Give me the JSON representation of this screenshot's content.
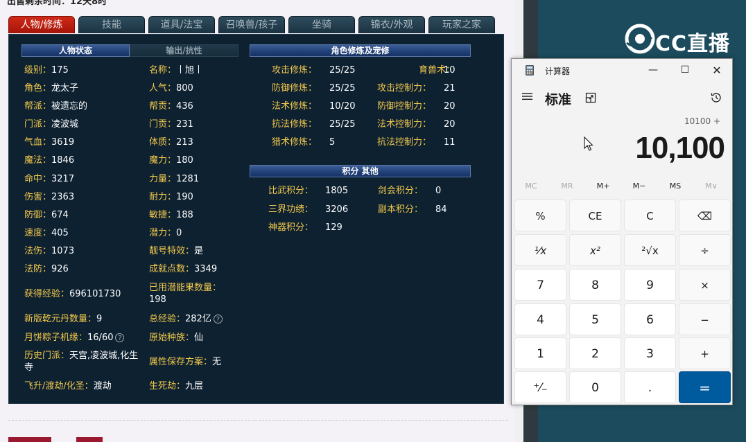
{
  "page": {
    "top_note": "出售剩余时间：12天8时",
    "tabs": [
      "人物/修炼",
      "技能",
      "道具/法宝",
      "召唤兽/孩子",
      "坐骑",
      "锦衣/外观",
      "玩家之家"
    ],
    "active_tab": "人物/修炼",
    "status": {
      "header_main": "人物状态",
      "header_alt": "输出/抗性",
      "col1": [
        {
          "label": "级别：",
          "value": "175"
        },
        {
          "label": "角色：",
          "value": "龙太子"
        },
        {
          "label": "帮派：",
          "value": "被遗忘的"
        },
        {
          "label": "门派：",
          "value": "凌波城"
        },
        {
          "label": "气血：",
          "value": "3619"
        },
        {
          "label": "魔法：",
          "value": "1846"
        },
        {
          "label": "命中：",
          "value": "3217"
        },
        {
          "label": "伤害：",
          "value": "2363"
        },
        {
          "label": "防御：",
          "value": "674"
        },
        {
          "label": "速度：",
          "value": "405"
        },
        {
          "label": "法伤：",
          "value": "1073"
        },
        {
          "label": "法防：",
          "value": "926"
        }
      ],
      "col2": [
        {
          "label": "名称：",
          "value": "丨旭丨"
        },
        {
          "label": "人气：",
          "value": "800"
        },
        {
          "label": "帮贡：",
          "value": "436"
        },
        {
          "label": "门贡：",
          "value": "231"
        },
        {
          "label": "体质：",
          "value": "213"
        },
        {
          "label": "魔力：",
          "value": "180"
        },
        {
          "label": "力量：",
          "value": "1281"
        },
        {
          "label": "耐力：",
          "value": "190"
        },
        {
          "label": "敏捷：",
          "value": "188"
        },
        {
          "label": "潜力：",
          "value": "0"
        },
        {
          "label": "靓号特效：",
          "value": "是"
        },
        {
          "label": "成就点数：",
          "value": "3349"
        }
      ],
      "exp_label": "获得经验：",
      "exp_value": "696101730",
      "used_fruit_label": "已用潜能果数量：",
      "used_fruit_value": "198",
      "qianyuan_label": "新版乾元丹数量：",
      "qianyuan_value": "9",
      "total_exp_label": "总经验：",
      "total_exp_value": "282亿",
      "zongzi_label": "月饼粽子机缘：",
      "zongzi_value": "16/60",
      "race_label": "原始种族：",
      "race_value": "仙",
      "history_label": "历史门派：",
      "history_value": "天宫,凌波城,化生寺",
      "save_plan_label": "属性保存方案：",
      "save_plan_value": "无",
      "ascend_label": "飞升/渡劫/化圣：",
      "ascend_value": "渡劫",
      "life_death_label": "生死劫：",
      "life_death_value": "九层"
    },
    "cultivation": {
      "header": "角色修炼及宠修",
      "left": [
        {
          "label": "攻击修炼：",
          "value": "25/25"
        },
        {
          "label": "防御修炼：",
          "value": "25/25"
        },
        {
          "label": "法术修炼：",
          "value": "10/20"
        },
        {
          "label": "抗法修炼：",
          "value": "25/25"
        },
        {
          "label": "猎术修炼：",
          "value": "5"
        }
      ],
      "right": [
        {
          "label": "育兽术：",
          "value": "10"
        },
        {
          "label": "攻击控制力：",
          "value": "21"
        },
        {
          "label": "防御控制力：",
          "value": "20"
        },
        {
          "label": "法术控制力：",
          "value": "20"
        },
        {
          "label": "抗法控制力：",
          "value": "11"
        }
      ]
    },
    "points": {
      "header": "积分 其他",
      "items": [
        {
          "label": "比武积分：",
          "value": "1805"
        },
        {
          "label": "剑会积分：",
          "value": "0"
        },
        {
          "label": "三界功绩：",
          "value": "3206"
        },
        {
          "label": "副本积分：",
          "value": "84"
        },
        {
          "label": "神器积分：",
          "value": "129"
        }
      ]
    }
  },
  "brand": {
    "logo_text": "CC直播"
  },
  "calculator": {
    "title": "计算器",
    "mode": "标准",
    "expression": "10100 +",
    "display": "10,100",
    "memory": [
      "MC",
      "MR",
      "M+",
      "M−",
      "MS",
      "M∨"
    ],
    "keys": [
      "%",
      "CE",
      "C",
      "⌫",
      "¹⁄x",
      "x²",
      "²√x",
      "÷",
      "7",
      "8",
      "9",
      "×",
      "4",
      "5",
      "6",
      "−",
      "1",
      "2",
      "3",
      "+",
      "⁺⁄₋",
      "0",
      ".",
      "="
    ],
    "accent": "#005a9e"
  },
  "colors": {
    "panel_bg": "#0e2131",
    "label_gold": "#f2c94c",
    "tab_active": "#c62416",
    "teal_bg": "#1b4b5c"
  }
}
